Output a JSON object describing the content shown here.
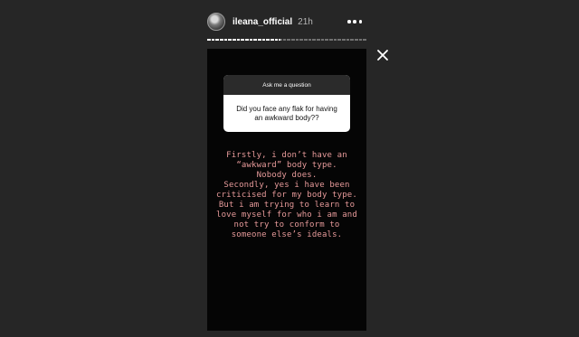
{
  "header": {
    "username": "ileana_official",
    "timestamp": "21h"
  },
  "icons": {
    "avatar": "profile-avatar",
    "more": "more-dots-icon",
    "close": "close-x-icon"
  },
  "progress": {
    "segments": [
      1,
      1,
      1,
      1,
      1,
      1,
      1,
      1,
      1,
      1,
      1,
      1,
      1,
      1,
      1,
      1,
      1,
      0.6,
      0,
      0,
      0,
      0,
      0,
      0,
      0,
      0,
      0,
      0,
      0,
      0,
      0,
      0,
      0,
      0,
      0,
      0,
      0,
      0
    ]
  },
  "story": {
    "question_box": {
      "title": "Ask me a question",
      "question": "Did you face any flak for having\nan awkward body??"
    },
    "answer": "Firstly, i don’t have an\n“awkward” body type.\nNobody does.\nSecondly, yes i have been\ncriticised for my body type.\nBut i am trying to learn to\nlove myself for who i am and\nnot try to conform to\nsomeone else’s ideals."
  },
  "colors": {
    "background": "#262626",
    "story_bg": "#050505",
    "answer_text": "#e79a9a"
  }
}
